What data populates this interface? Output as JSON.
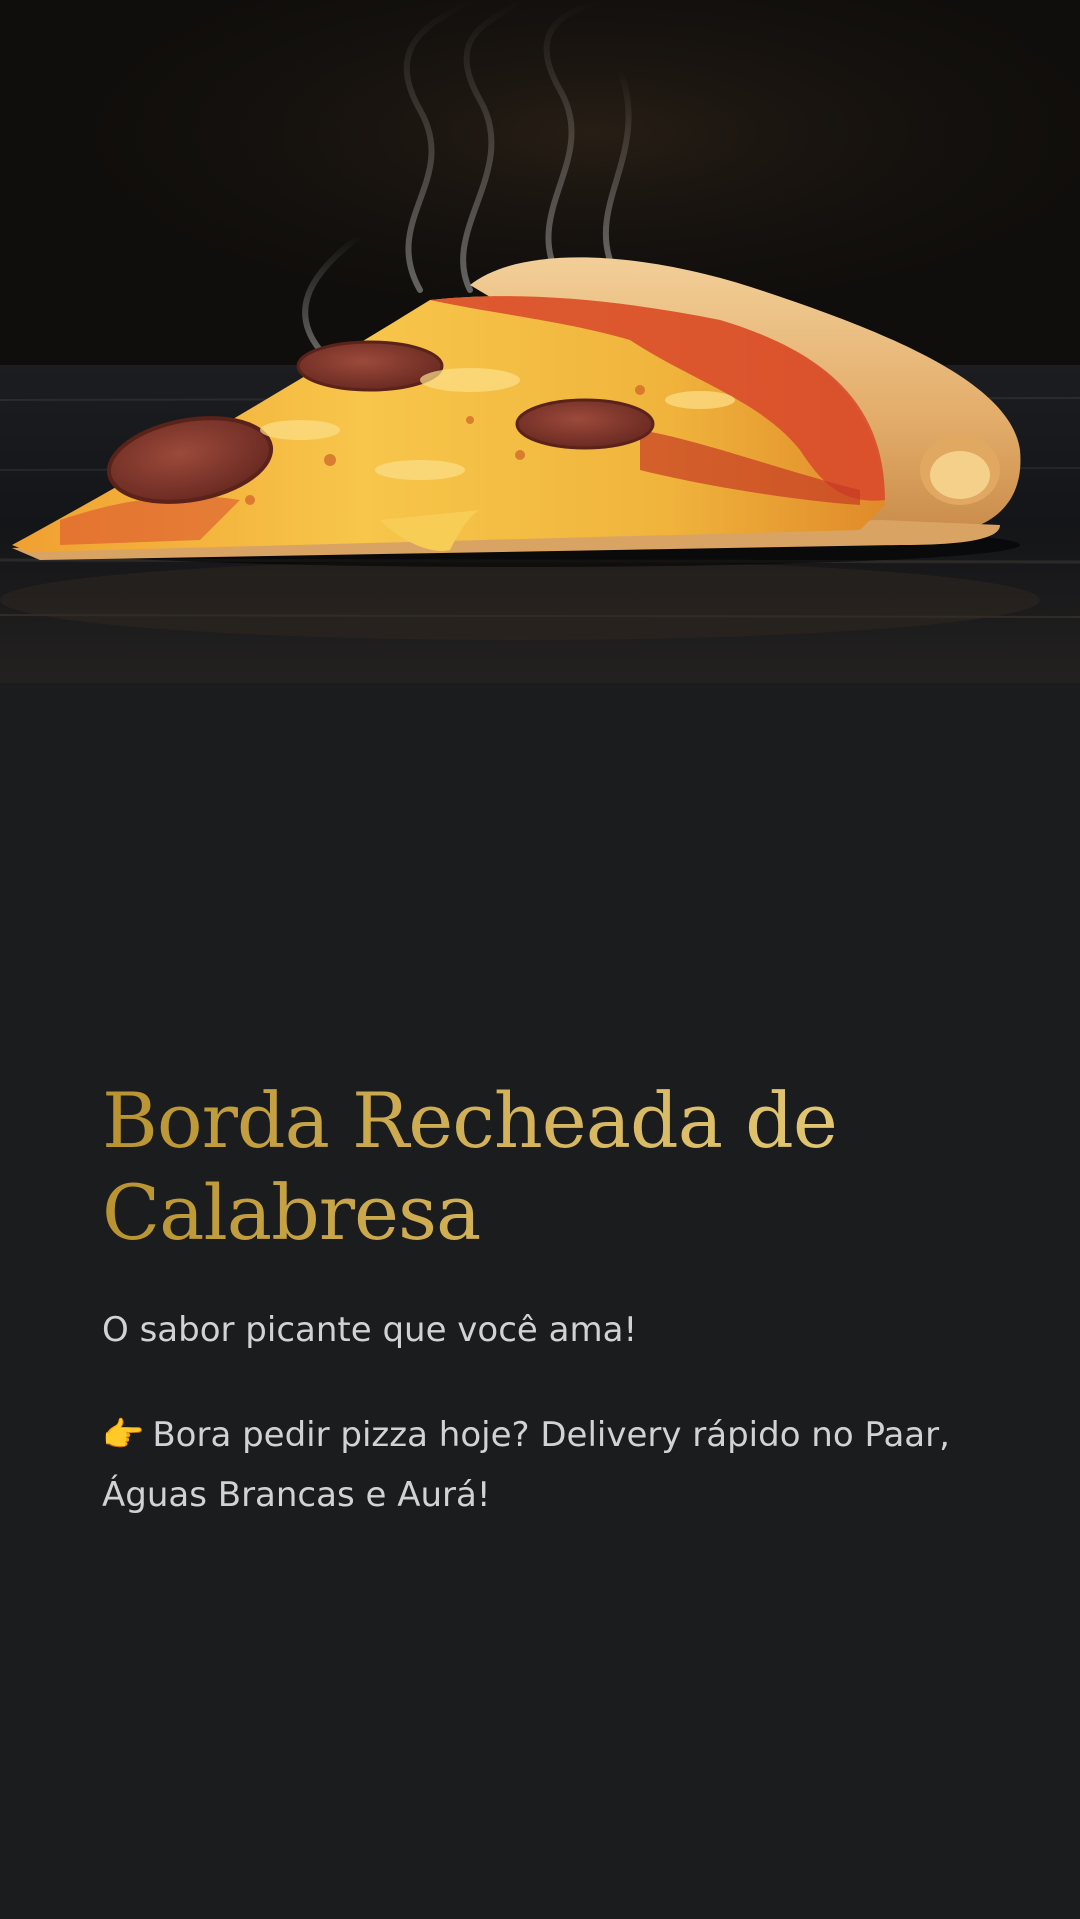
{
  "hero": {
    "image_alt": "Fatia de pizza de calabresa com borda recheada"
  },
  "content": {
    "title": "Borda Recheada de Calabresa",
    "subtitle": "O sabor picante que você ama!",
    "cta_emoji": "👉",
    "cta_text": "Bora pedir pizza hoje? Delivery rápido no Paar, Águas Brancas e Aurá!"
  },
  "colors": {
    "background": "#1b1c1e",
    "title_gold": "#d4b25a",
    "body_text": "#d2d2d2"
  }
}
